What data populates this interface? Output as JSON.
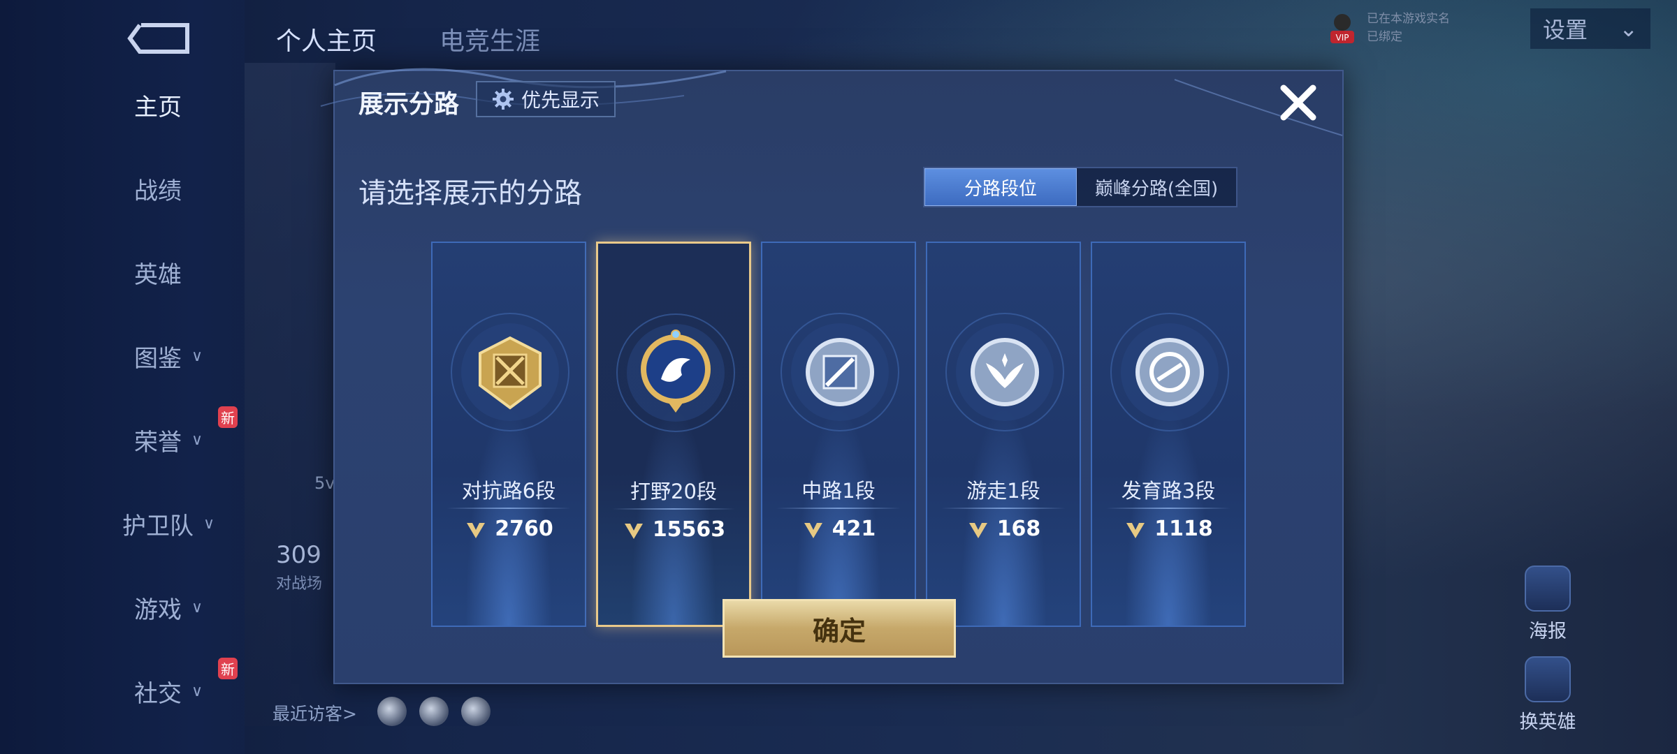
{
  "background": {
    "top_tabs": [
      "个人主页",
      "电竞生涯"
    ],
    "settings_label": "设置",
    "vip_lines": [
      "已在本游戏实名",
      "已绑定"
    ],
    "vip_label": "VIP",
    "nav_items": [
      {
        "label": "主页",
        "active": true,
        "chevron": false,
        "new": false
      },
      {
        "label": "战绩",
        "active": false,
        "chevron": false,
        "new": false
      },
      {
        "label": "英雄",
        "active": false,
        "chevron": false,
        "new": false
      },
      {
        "label": "图鉴",
        "active": false,
        "chevron": true,
        "new": false
      },
      {
        "label": "荣誉",
        "active": false,
        "chevron": true,
        "new": true
      },
      {
        "label": "护卫队",
        "active": false,
        "chevron": true,
        "new": false
      },
      {
        "label": "游戏",
        "active": false,
        "chevron": true,
        "new": false
      },
      {
        "label": "社交",
        "active": false,
        "chevron": true,
        "new": true
      }
    ],
    "new_badge": "新",
    "left_count": "5v",
    "left_stat": "309",
    "left_stat_sub": "对战场",
    "recent_visitors": "最近访客>",
    "right_buttons": [
      "海报",
      "换英雄"
    ]
  },
  "dialog": {
    "title": "展示分路",
    "priority_button": "优先显示",
    "subtitle": "请选择展示的分路",
    "toggle": {
      "options": [
        "分路段位",
        "巅峰分路(全国)"
      ],
      "selected": 0
    },
    "cards": [
      {
        "name": "对抗路6段",
        "points": "2760",
        "selected": false,
        "badge": "gold",
        "emblem": "swords"
      },
      {
        "name": "打野20段",
        "points": "15563",
        "selected": true,
        "badge": "gold-blue",
        "emblem": "dragon"
      },
      {
        "name": "中路1段",
        "points": "421",
        "selected": false,
        "badge": "silver",
        "emblem": "staff"
      },
      {
        "name": "游走1段",
        "points": "168",
        "selected": false,
        "badge": "silver",
        "emblem": "wings"
      },
      {
        "name": "发育路3段",
        "points": "1118",
        "selected": false,
        "badge": "silver",
        "emblem": "arrow"
      }
    ],
    "confirm_button": "确定"
  },
  "colors": {
    "gold": "#e9c98a",
    "accent_blue": "#4f7fd4",
    "confirm": "#d6bd84"
  }
}
